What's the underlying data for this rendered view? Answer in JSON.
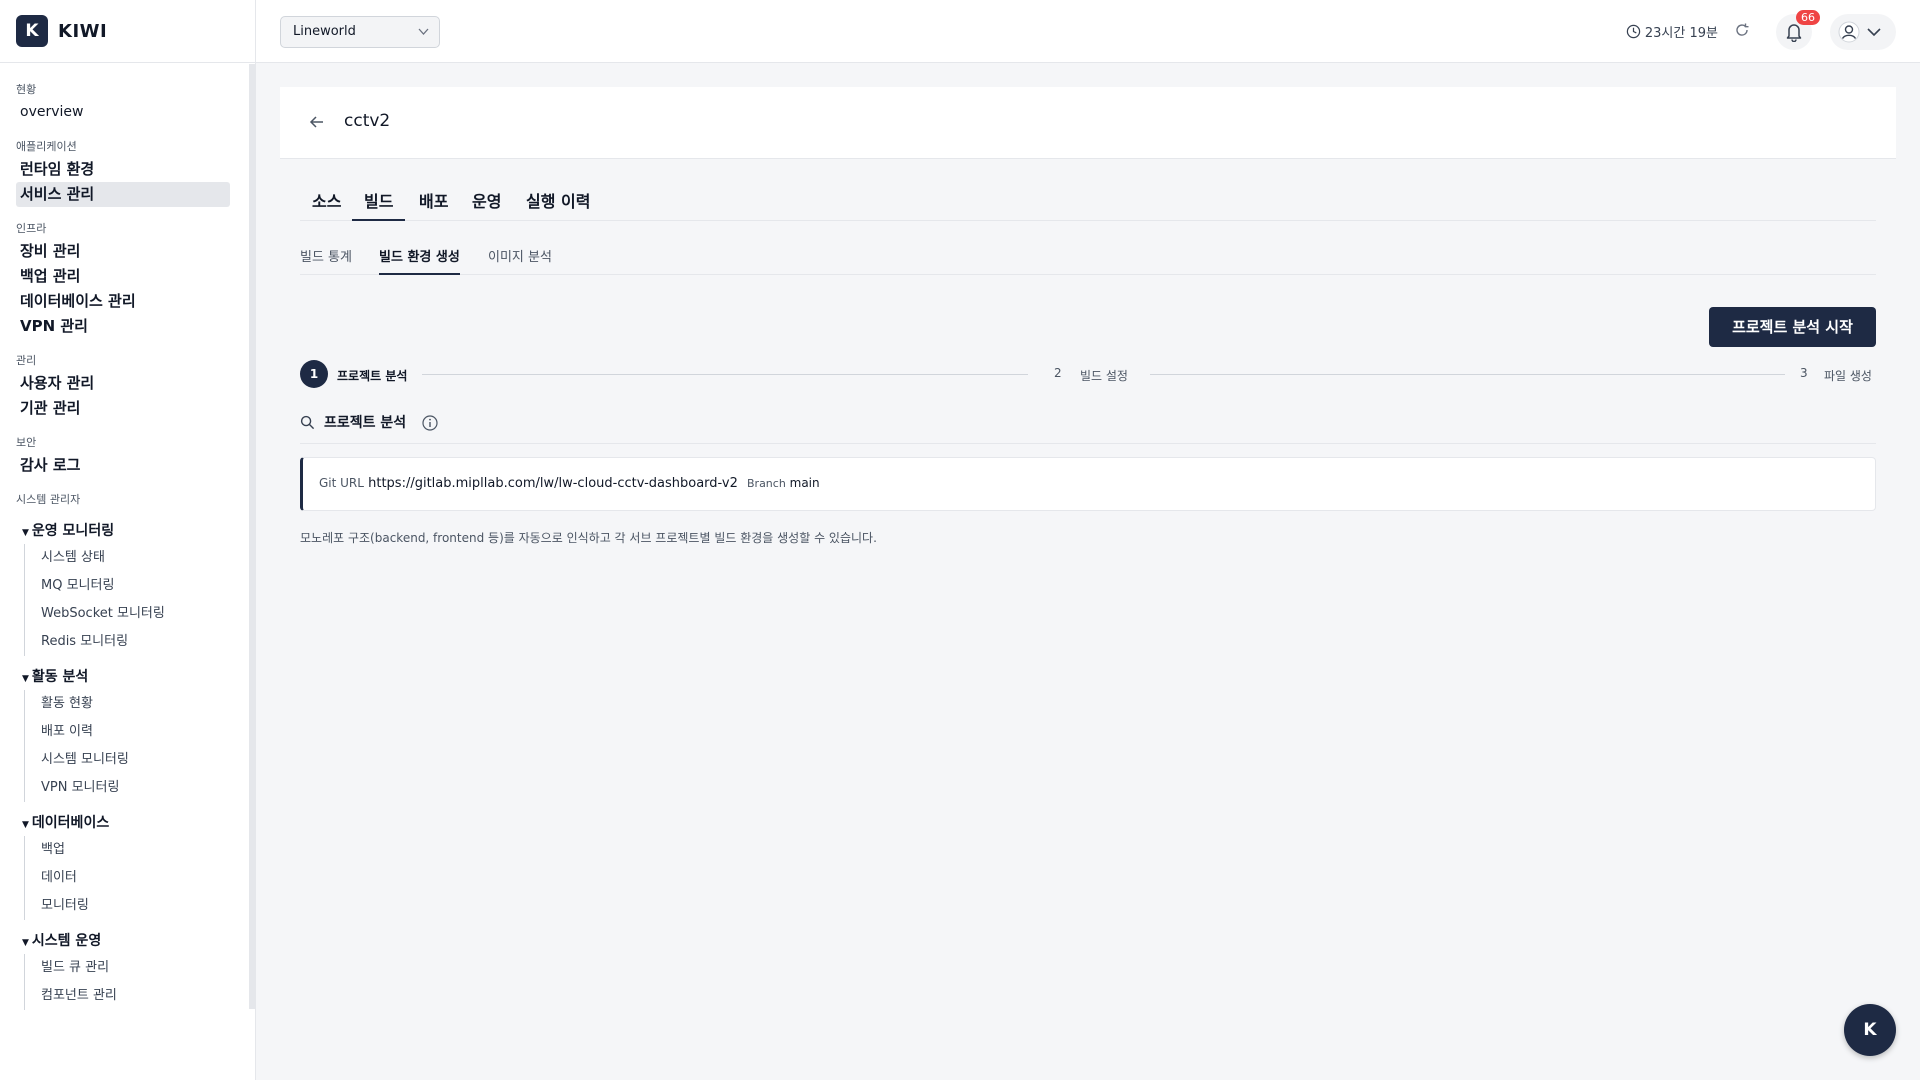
{
  "brand": {
    "logo_letter": "K",
    "name": "KIWI"
  },
  "sidebar": {
    "sections": [
      {
        "title": "현황",
        "items": [
          "overview"
        ]
      },
      {
        "title": "애플리케이션",
        "items": [
          "런타임 환경",
          "서비스 관리"
        ]
      },
      {
        "title": "인프라",
        "items": [
          "장비 관리",
          "백업 관리",
          "데이터베이스 관리",
          "VPN 관리"
        ]
      },
      {
        "title": "관리",
        "items": [
          "사용자 관리",
          "기관 관리"
        ]
      },
      {
        "title": "보안",
        "items": [
          "감사 로그"
        ]
      },
      {
        "title": "시스템 관리자"
      }
    ],
    "active_item": "서비스 관리",
    "groups": [
      {
        "title": "운영 모니터링",
        "items": [
          "시스템 상태",
          "MQ 모니터링",
          "WebSocket 모니터링",
          "Redis 모니터링"
        ]
      },
      {
        "title": "활동 분석",
        "items": [
          "활동 현황",
          "배포 이력",
          "시스템 모니터링",
          "VPN 모니터링"
        ]
      },
      {
        "title": "데이터베이스",
        "items": [
          "백업",
          "데이터",
          "모니터링"
        ]
      },
      {
        "title": "시스템 운영",
        "items": [
          "빌드 큐 관리",
          "컴포넌트 관리"
        ]
      }
    ]
  },
  "header": {
    "org_select": "Lineworld",
    "session_remaining": "23시간 19분",
    "notification_count": "66",
    "icons": [
      "clock-icon",
      "refresh-icon",
      "bell-icon",
      "user-icon",
      "chevron-down-icon"
    ]
  },
  "page": {
    "title": "cctv2",
    "main_tabs": [
      "소스",
      "빌드",
      "배포",
      "운영",
      "실행 이력"
    ],
    "main_tab_active": "빌드",
    "sub_tabs": [
      "빌드 통계",
      "빌드 환경 생성",
      "이미지 분석"
    ],
    "sub_tab_active": "빌드 환경 생성",
    "start_button": "프로젝트 분석 시작",
    "steps": [
      {
        "num": "1",
        "label": "프로젝트 분석",
        "active": true
      },
      {
        "num": "2",
        "label": "빌드 설정",
        "active": false
      },
      {
        "num": "3",
        "label": "파일 생성",
        "active": false
      }
    ],
    "section_title": "프로젝트 분석",
    "repo": {
      "git_label": "Git URL",
      "git_url": "https://gitlab.mipllab.com/lw/lw-cloud-cctv-dashboard-v2",
      "branch_label": "Branch",
      "branch": "main"
    },
    "hint": "모노레포 구조(backend, frontend 등)를 자동으로 인식하고 각 서브 프로젝트별 빌드 환경을 생성할 수 있습니다."
  },
  "fab_letter": "K",
  "colors": {
    "primary": "#1e2a44",
    "badge": "#ef4444",
    "active_bg": "#e5e7eb"
  }
}
